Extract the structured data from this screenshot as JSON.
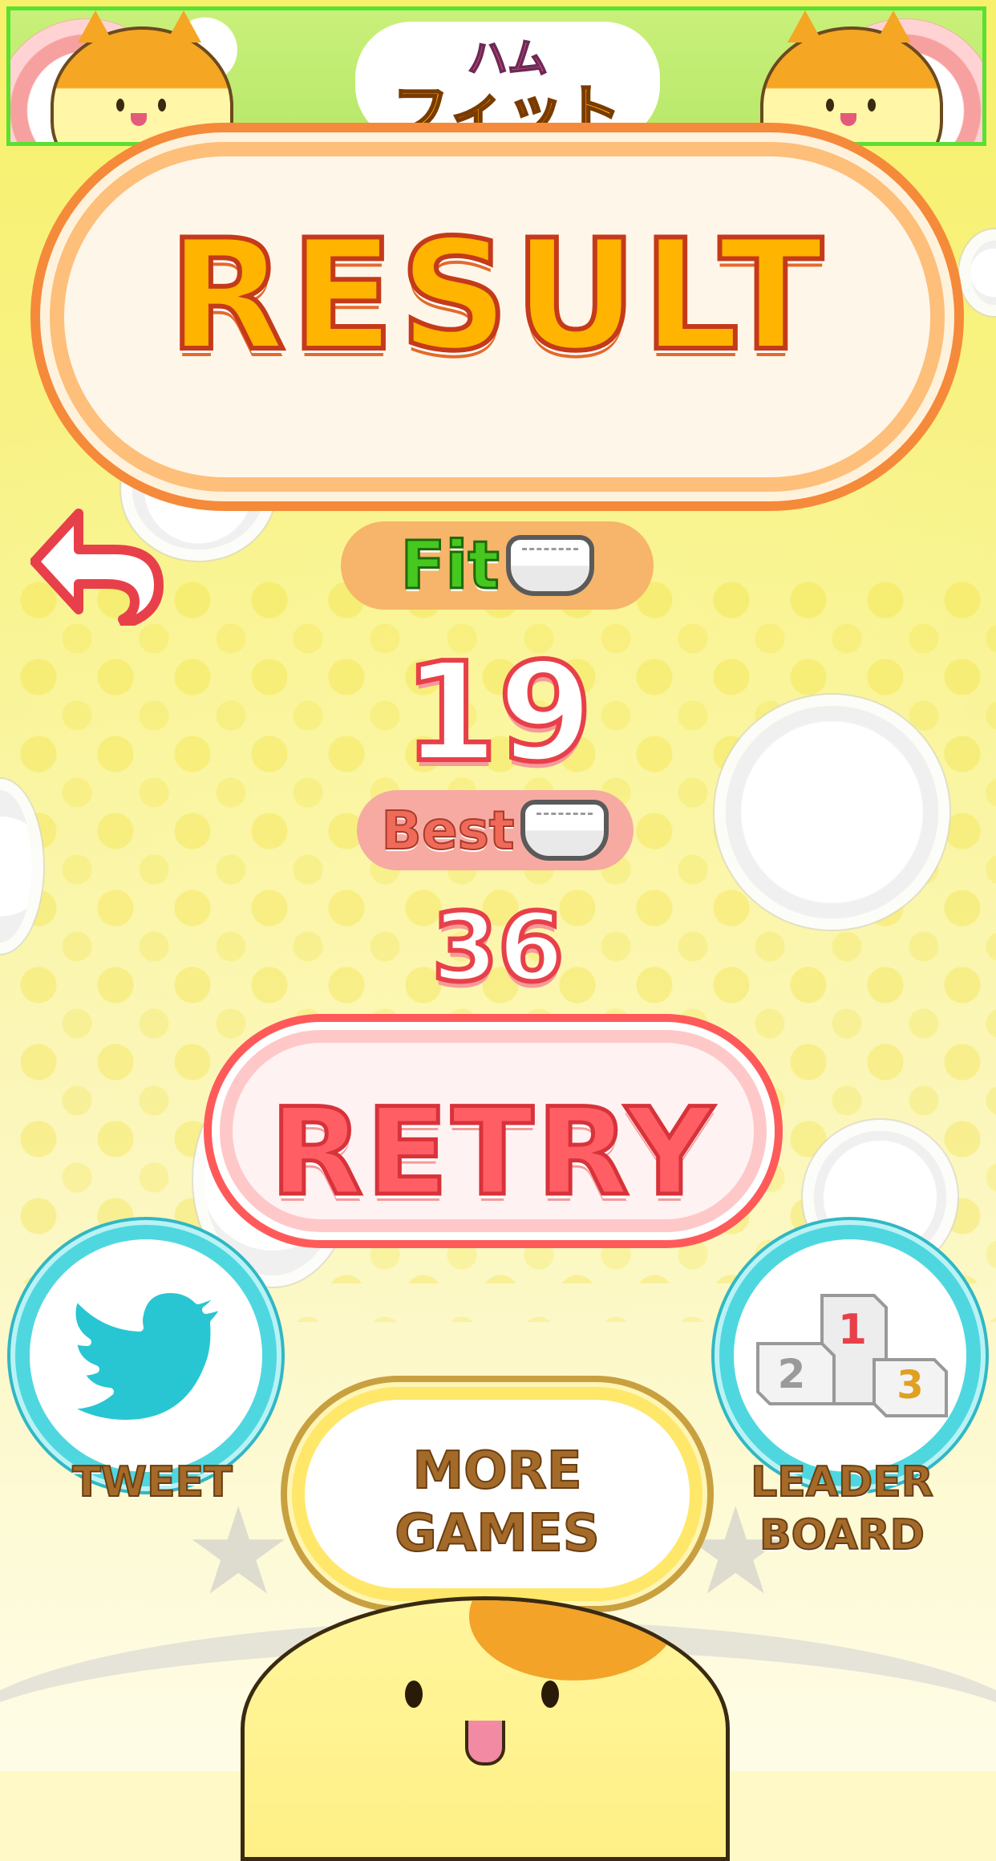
{
  "banner": {
    "logo_top": "ハム",
    "logo_main": "フィット"
  },
  "title": "RESULT",
  "fit": {
    "label": "Fit",
    "score": "19"
  },
  "best": {
    "label": "Best",
    "score": "36"
  },
  "buttons": {
    "retry": "RETRY",
    "tweet": "TWEET",
    "more_games_line1": "MORE",
    "more_games_line2": "GAMES",
    "leaderboard_line1": "LEADER",
    "leaderboard_line2": "BOARD"
  },
  "podium": {
    "first": "1",
    "second": "2",
    "third": "3"
  },
  "icons": {
    "back": "back-arrow-icon",
    "tweet": "twitter-bird-icon",
    "leaderboard": "podium-icon",
    "score_unit": "diaper-icon"
  },
  "colors": {
    "banner_border": "#5ae030",
    "title_fill": "#ffb400",
    "title_outline": "#c53a1a",
    "fit_green": "#46c81e",
    "score_red": "#e8404a",
    "retry_red": "#ff5e64",
    "button_teal": "#4fd7e0",
    "caption_brown": "#a36a2a"
  }
}
